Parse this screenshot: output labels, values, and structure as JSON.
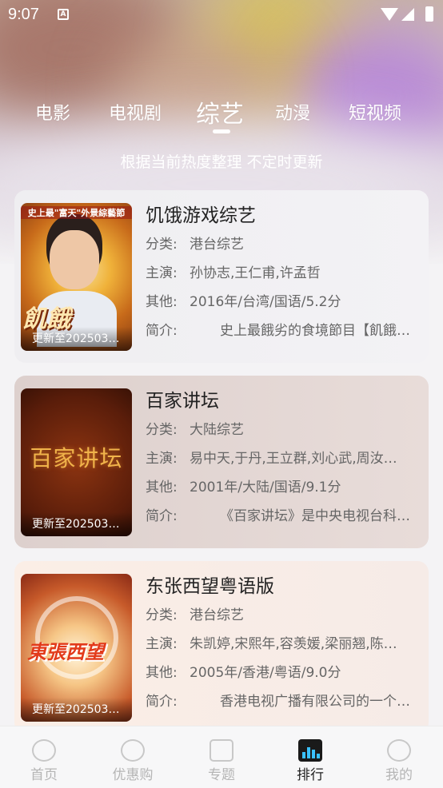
{
  "status_bar": {
    "time": "9:07",
    "notif_icon": "A"
  },
  "tabs": [
    {
      "label": "电影"
    },
    {
      "label": "电视剧"
    },
    {
      "label": "综艺",
      "active": true
    },
    {
      "label": "动漫"
    },
    {
      "label": "短视频"
    }
  ],
  "subtitle": "根据当前热度整理 不定时更新",
  "labels": {
    "category": "分类:",
    "cast": "主演:",
    "other": "其他:",
    "intro": "简介:"
  },
  "items": [
    {
      "title": "饥饿游戏综艺",
      "category": "港台综艺",
      "cast": "孙协志,王仁甫,许孟哲",
      "other": "2016年/台湾/国语/5.2分",
      "intro": "史上最餓劣的食境節目【飢餓…",
      "update": "更新至202503…",
      "poster": {
        "top_text": "史上最\"富天\"外景綜藝節",
        "big_text": "飢餓"
      }
    },
    {
      "title": "百家讲坛",
      "category": "大陆综艺",
      "cast": "易中天,于丹,王立群,刘心武,周汝…",
      "other": "2001年/大陆/国语/9.1分",
      "intro": "《百家讲坛》是中央电视台科…",
      "update": "更新至202503…",
      "poster": {
        "title_text": "百家讲坛"
      }
    },
    {
      "title": "东张西望粤语版",
      "category": "港台综艺",
      "cast": "朱凯婷,宋熙年,容羡媛,梁丽翘,陈…",
      "other": "2005年/香港/粤语/9.0分",
      "intro": "香港电视广播有限公司的一个…",
      "update": "更新至202503…",
      "poster": {
        "title_text": "東張西望"
      }
    }
  ],
  "bottom_nav": [
    {
      "label": "首页",
      "icon": "home-icon"
    },
    {
      "label": "优惠购",
      "icon": "discount-icon"
    },
    {
      "label": "专题",
      "icon": "topic-icon"
    },
    {
      "label": "排行",
      "icon": "rank-icon",
      "active": true
    },
    {
      "label": "我的",
      "icon": "profile-icon"
    }
  ]
}
